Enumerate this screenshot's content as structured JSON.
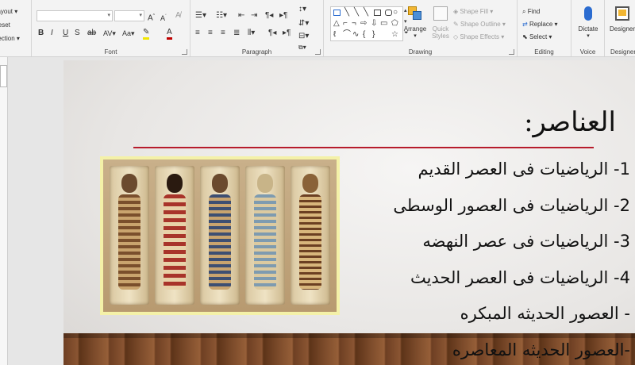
{
  "ribbon": {
    "slides_group": {
      "layout": "Layout",
      "reset": "Reset",
      "section": "Section"
    },
    "font_group": {
      "label": "Font",
      "font_name": "",
      "font_size": ""
    },
    "paragraph_group": {
      "label": "Paragraph"
    },
    "drawing_group": {
      "label": "Drawing",
      "arrange": "Arrange",
      "quick_styles_line1": "Quick",
      "quick_styles_line2": "Styles",
      "shape_fill": "Shape Fill",
      "shape_outline": "Shape Outline",
      "shape_effects": "Shape Effects"
    },
    "editing_group": {
      "label": "Editing",
      "find": "Find",
      "replace": "Replace",
      "select": "Select"
    },
    "voice_group": {
      "label": "Voice",
      "dictate": "Dictate"
    },
    "designer_group": {
      "label": "Designer",
      "designer": "Designer"
    }
  },
  "slide": {
    "title": "العناصر:",
    "rule_color": "#b71c2c",
    "items": [
      "1- الرياضيات فى العصر القديم",
      "2- الرياضيات فى العصور الوسطى",
      "3- الرياضيات فى عصر النهضه",
      "4- الرياضيات فى العصر الحديث",
      "- العصور الحديثه المبكره",
      "-العصور الحديثه المعاصره"
    ]
  }
}
